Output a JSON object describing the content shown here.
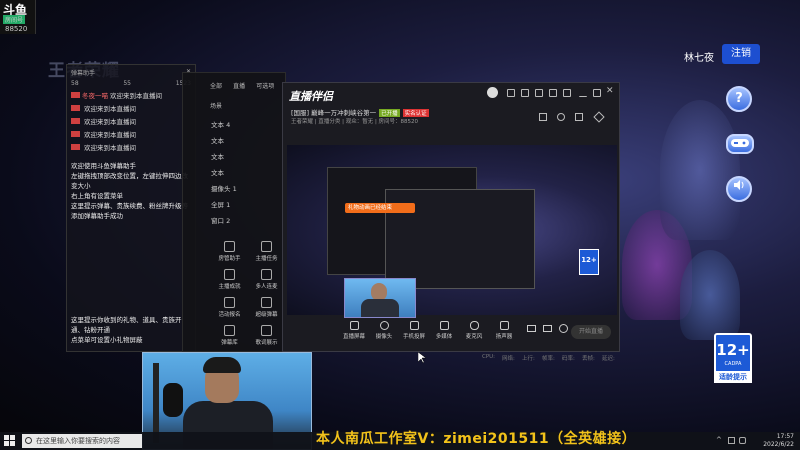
{
  "site": {
    "logo_text": "斗鱼",
    "logo_sub": "房间号",
    "room_number": "88520"
  },
  "wallpaper": {
    "game_logo": "王者荣耀"
  },
  "user": {
    "name": "林七夜",
    "logout_label": "注销"
  },
  "right_controls": {
    "help_icon": "question-icon",
    "gamepad_icon": "gamepad-icon",
    "volume_icon": "speaker-icon"
  },
  "chat": {
    "header": "弹幕助手",
    "stats": [
      "58",
      "55",
      "1523"
    ],
    "welcome_suffix": "欢迎来到本直播间",
    "messages": [
      {
        "nick": "冬夜一喵",
        "text": "欢迎来到本直播间"
      },
      {
        "nick": "",
        "text": "欢迎来到本直播间"
      },
      {
        "nick": "",
        "text": "欢迎来到本直播间"
      },
      {
        "nick": "",
        "text": "欢迎来到本直播间"
      },
      {
        "nick": "",
        "text": "欢迎来到本直播间"
      }
    ],
    "info_lines": [
      "欢迎使用斗鱼弹幕助手",
      "左键拖拽顶部改变位置，左键拉伸四边改变大小",
      "右上角有设置菜单",
      "这里提示弹幕、贵族续费、粉丝牌升级等",
      "添加弹幕助手成功"
    ],
    "footer_lines": [
      "这里提示你收到的礼物、道具、贵族开通、钻粉开通",
      "点菜单可设置小礼物屏蔽"
    ]
  },
  "assistant": {
    "tabs": [
      "全部",
      "直播",
      "可选项",
      "场景"
    ],
    "scenes": [
      "文本 4",
      "文本",
      "文本",
      "文本",
      "摄像头 1",
      "全屏 1",
      "窗口 2"
    ],
    "tools": [
      {
        "label": "房管助手",
        "icon": "user-icon"
      },
      {
        "label": "主播任务",
        "icon": "task-icon"
      },
      {
        "label": "主播成就",
        "icon": "medal-icon"
      },
      {
        "label": "多人连麦",
        "icon": "people-icon"
      },
      {
        "label": "活动报名",
        "icon": "flag-icon"
      },
      {
        "label": "超级弹幕",
        "icon": "danmaku-icon"
      },
      {
        "label": "弹幕库",
        "icon": "list-icon"
      },
      {
        "label": "歌词展示",
        "icon": "music-icon"
      }
    ]
  },
  "app": {
    "logo": "直播伴侣",
    "room_title": "[国服] 巅峰一万冲刺峡谷第一",
    "badge_green": "已开播",
    "badge_red": "实名认证",
    "meta": "王者荣耀 | 直播分类 | 观众：暂无 | 房间号：88520",
    "preview_error": "礼物动画已经结束",
    "toolbar": [
      {
        "label": "直播屏幕",
        "icon": "screen-icon"
      },
      {
        "label": "摄像头",
        "icon": "camera-icon"
      },
      {
        "label": "手机投屏",
        "icon": "phone-icon"
      },
      {
        "label": "多媒体",
        "icon": "media-icon"
      },
      {
        "label": "麦克风",
        "icon": "mic-icon"
      },
      {
        "label": "扬声器",
        "icon": "speaker-icon"
      }
    ],
    "start_live": "开始直播",
    "status": [
      "CPU:",
      "网络:",
      "上行:",
      "帧率:",
      "码率:",
      "丢帧:",
      "延迟:"
    ]
  },
  "cadpa": {
    "age": "12+",
    "org": "CADPA",
    "tip": "适龄提示"
  },
  "promo": "本人南瓜工作室V：zimei201511（全英雄接）",
  "taskbar": {
    "search_placeholder": "在这里输入你要搜索的内容",
    "time": "17:57",
    "date": "2022/6/22"
  },
  "colors": {
    "accent_blue": "#1d4fd0",
    "promo_yellow": "#f2c21a",
    "error_orange": "#f26d1a"
  }
}
